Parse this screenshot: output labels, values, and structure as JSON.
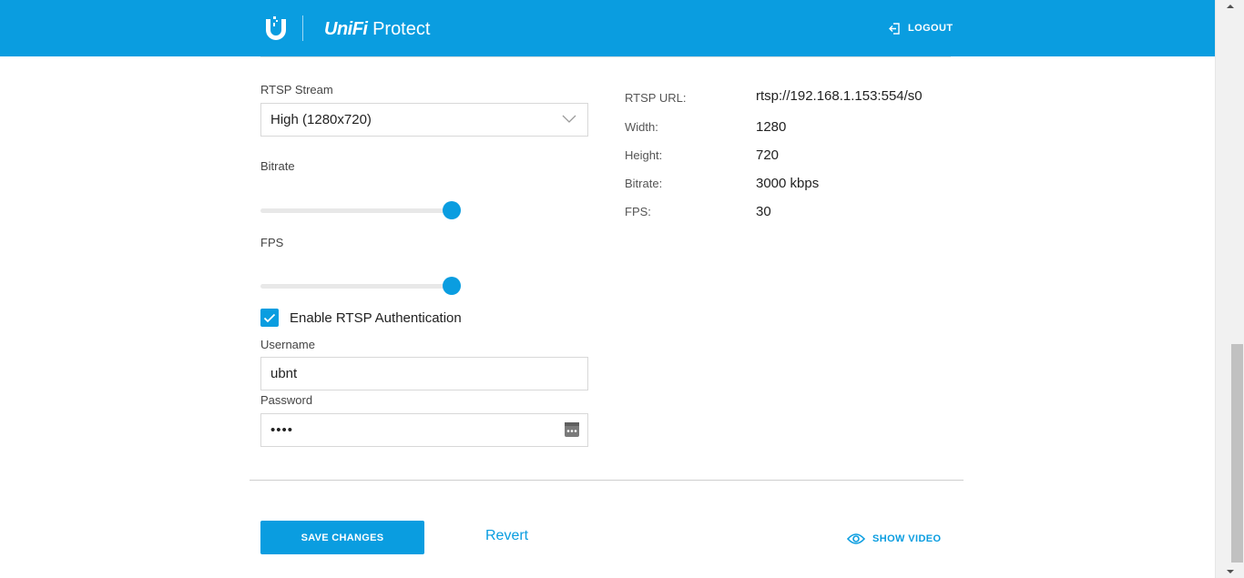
{
  "header": {
    "brand": "UniFi",
    "product": "Protect",
    "logout_label": "LOGOUT"
  },
  "stream": {
    "label": "RTSP Stream",
    "selected": "High (1280x720)"
  },
  "bitrate_slider": {
    "label": "Bitrate",
    "level": 1.0
  },
  "fps_slider": {
    "label": "FPS",
    "level": 1.0
  },
  "auth": {
    "checkbox_label": "Enable RTSP Authentication",
    "checked": true,
    "username_label": "Username",
    "username_value": "ubnt",
    "password_label": "Password",
    "password_value": "••••"
  },
  "info": {
    "rows": [
      {
        "label": "RTSP URL:",
        "value": "rtsp://192.168.1.153:554/s0"
      },
      {
        "label": "Width:",
        "value": "1280"
      },
      {
        "label": "Height:",
        "value": "720"
      },
      {
        "label": "Bitrate:",
        "value": "3000 kbps"
      },
      {
        "label": "FPS:",
        "value": "30"
      }
    ]
  },
  "actions": {
    "save_label": "SAVE CHANGES",
    "revert_label": "Revert",
    "show_video_label": "SHOW VIDEO"
  },
  "colors": {
    "accent": "#0a9de0",
    "header_bg": "#0a9de0"
  },
  "icons": {
    "logo": "ubiquiti-u-logo-icon",
    "logout": "logout-icon",
    "dropdown": "chevron-down-icon",
    "checkbox": "checkmark-icon",
    "password": "password-key-icon",
    "show_video": "eye-icon"
  }
}
